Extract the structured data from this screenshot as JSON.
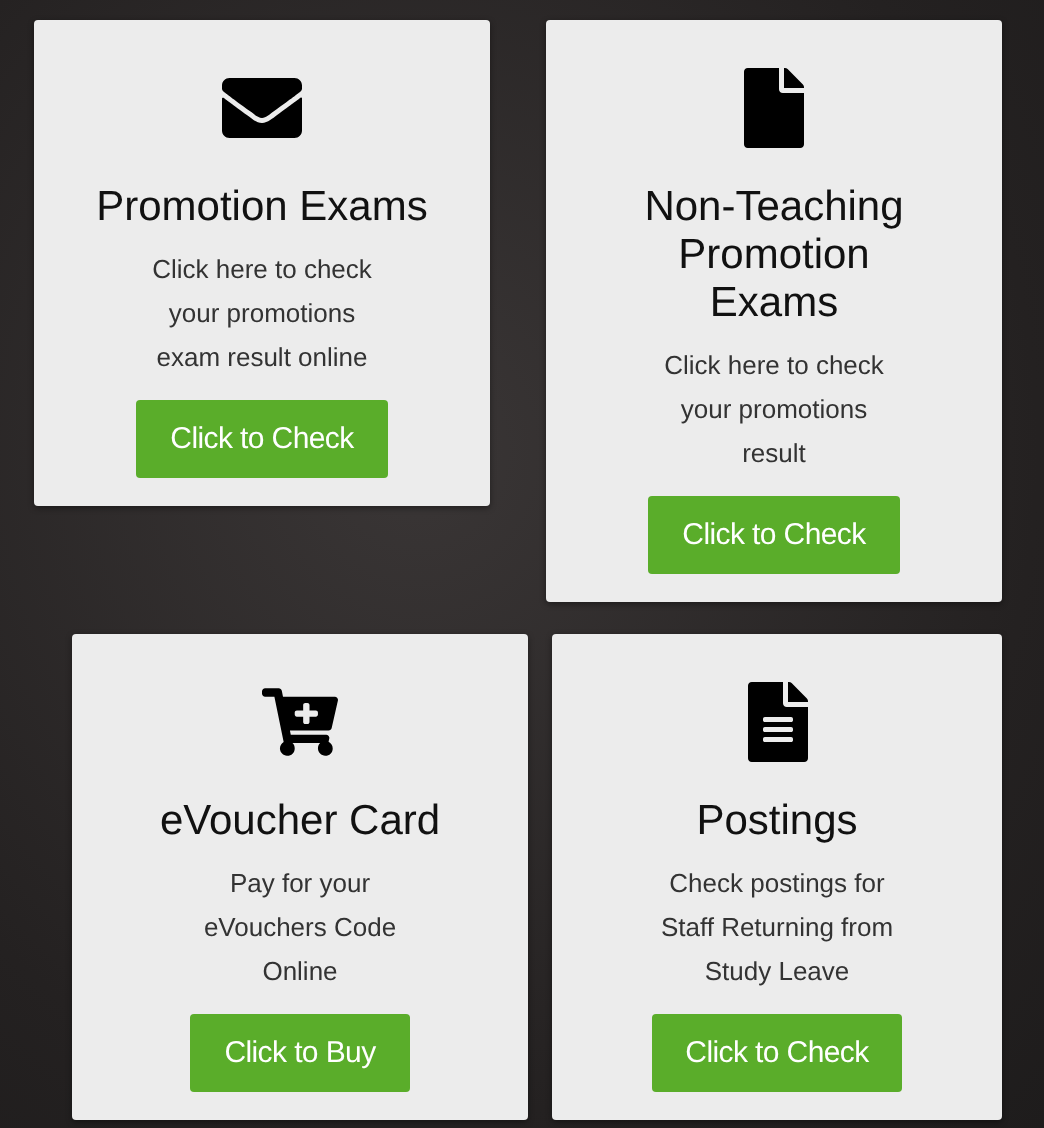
{
  "cards": [
    {
      "kind": "mail",
      "title": "Promotion Exams",
      "text": [
        "Click here to check",
        "your promotions",
        "exam result online"
      ],
      "button": "Click to Check"
    },
    {
      "kind": "document",
      "title": "Non-Teaching Promotion Exams",
      "text": [
        "Click here to check",
        "your promotions",
        "result"
      ],
      "button": "Click to Check"
    },
    {
      "kind": "cart",
      "title": "eVoucher Card",
      "text": [
        "Pay for your",
        "eVouchers Code",
        "Online"
      ],
      "button": "Click to Buy"
    },
    {
      "kind": "notes",
      "title": "Postings",
      "text": [
        "Check postings for",
        "Staff Returning from",
        "Study Leave"
      ],
      "button": "Click to Check"
    }
  ]
}
